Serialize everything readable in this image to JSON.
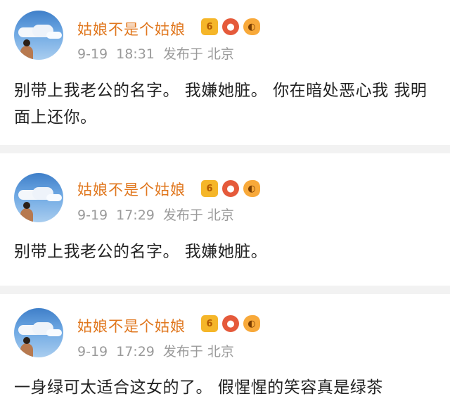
{
  "posts": [
    {
      "author": "姑娘不是个姑娘",
      "date": "9-19",
      "time": "18:31",
      "posted_from": "发布于 北京",
      "text": "别带上我老公的名字。  我嫌她脏。 你在暗处恶心我  我明面上还你。"
    },
    {
      "author": "姑娘不是个姑娘",
      "date": "9-19",
      "time": "17:29",
      "posted_from": "发布于 北京",
      "text": "别带上我老公的名字。  我嫌她脏。"
    },
    {
      "author": "姑娘不是个姑娘",
      "date": "9-19",
      "time": "17:29",
      "posted_from": "发布于 北京",
      "text": "一身绿可太适合这女的了。 假惺惺的笑容真是绿茶"
    }
  ],
  "badges": {
    "crown_icon": "crown-vip-icon",
    "fruit_icon": "fruit-icon",
    "fish_icon": "fish-icon",
    "crown_label": "6"
  },
  "colors": {
    "author": "#e0771e",
    "meta": "#9a9a9a",
    "separator": "#f2f2f2"
  }
}
